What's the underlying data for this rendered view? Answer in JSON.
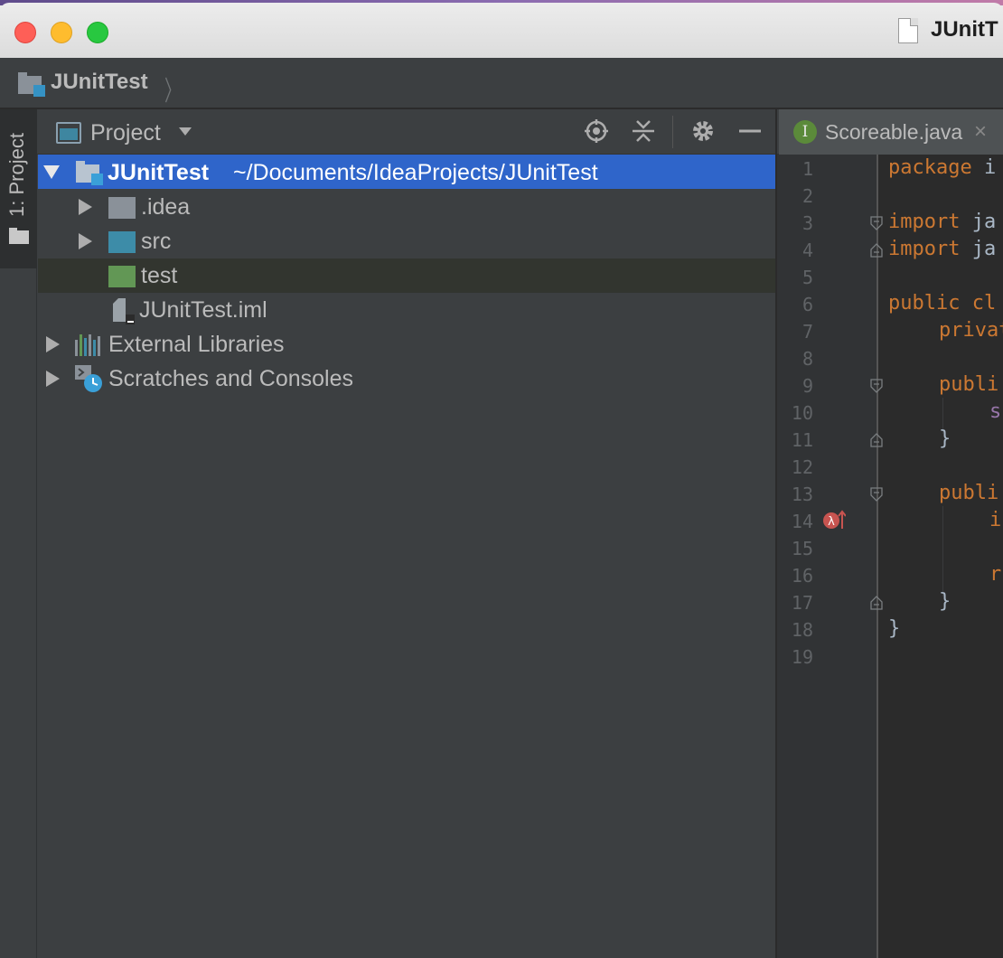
{
  "window": {
    "title": "JUnitT"
  },
  "navbar": {
    "module": "JUnitTest"
  },
  "toolstrip": {
    "project_tab": "1: Project"
  },
  "project_panel": {
    "title": "Project",
    "tree": {
      "root": {
        "name": "JUnitTest",
        "path": "~/Documents/IdeaProjects/JUnitTest"
      },
      "children": [
        ".idea",
        "src",
        "test",
        "JUnitTest.iml"
      ],
      "external_libraries": "External Libraries",
      "scratches": "Scratches and Consoles"
    }
  },
  "editor": {
    "tab": {
      "icon": "I",
      "label": "Scoreable.java",
      "close": "×"
    },
    "line_numbers": [
      "1",
      "2",
      "3",
      "4",
      "5",
      "6",
      "7",
      "8",
      "9",
      "10",
      "11",
      "12",
      "13",
      "14",
      "15",
      "16",
      "17",
      "18",
      "19"
    ],
    "lines": {
      "l1_kw": "package",
      "l1_rest": " i",
      "l3_kw": "import",
      "l3_rest": " ja",
      "l4_kw": "import",
      "l4_rest": " ja",
      "l6_kw": "public",
      "l6_kw2": " cl",
      "l7_kw": "privat",
      "l9_kw": "publi",
      "l10_text": "s",
      "l11_text": "}",
      "l13_kw": "publi",
      "l14_text": "i",
      "l16_text": "r",
      "l17_text": "}",
      "l18_text": "}"
    }
  },
  "colors": {
    "keyword": "#cc7832",
    "selection": "#2f65ca",
    "test_folder": "#629755",
    "source_folder": "#3d8ca8"
  }
}
